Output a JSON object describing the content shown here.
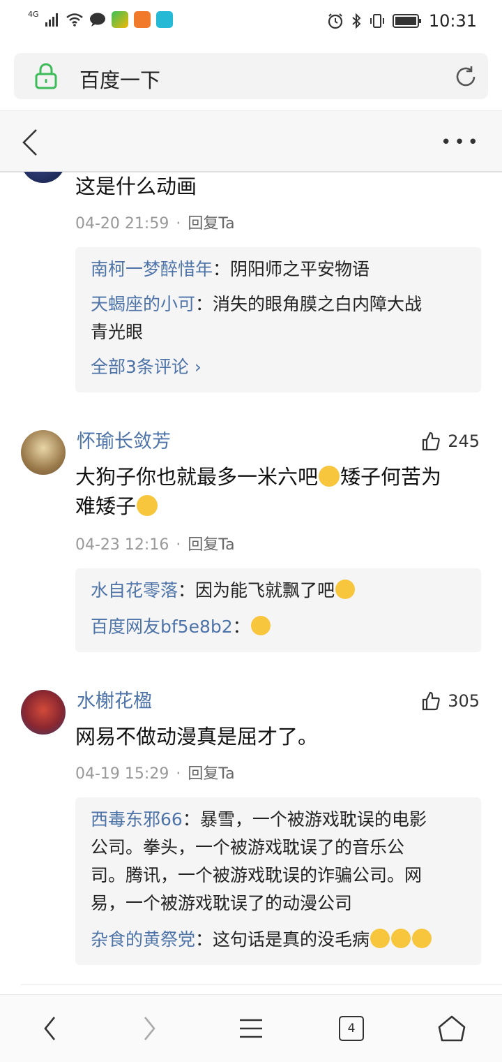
{
  "status_bar": {
    "network": "4G",
    "time": "10:31"
  },
  "url_bar": {
    "title": "百度一下"
  },
  "comments_top_fragment": {
    "text": "这是什么动画",
    "time": "04-20 21:59",
    "sep": "·",
    "reply_label": "回复Ta",
    "replies": [
      {
        "name": "南柯一梦醉惜年",
        "colon": "：",
        "text": "阴阳师之平安物语"
      },
      {
        "name": "天蝎座的小可",
        "colon": "：",
        "text": "消失的眼角膜之白内障大战",
        "text2": "青光眼"
      }
    ],
    "all_label": "全部3条评论 ›"
  },
  "comment_2": {
    "username": "怀瑜长敛芳",
    "likes": "245",
    "text_a": "大狗子你也就最多一米六吧",
    "text_b": "矮子何苦为",
    "text_c": "难矮子",
    "time": "04-23 12:16",
    "sep": "·",
    "reply_label": "回复Ta",
    "replies": [
      {
        "name": "水自花零落",
        "colon": "：",
        "text": "因为能飞就飘了吧"
      },
      {
        "name": "百度网友bf5e8b2",
        "colon": "：",
        "text": ""
      }
    ]
  },
  "comment_3": {
    "username": "水榭花楹",
    "likes": "305",
    "text": "网易不做动漫真是屈才了。",
    "time": "04-19 15:29",
    "sep": "·",
    "reply_label": "回复Ta",
    "replies": [
      {
        "name": "西毒东邪66",
        "colon": "：",
        "line1": "暴雪，一个被游戏耽误的电影",
        "line2": "公司。拳头，一个被游戏耽误了的音乐公",
        "line3": "司。腾讯，一个被游戏耽误的诈骗公司。网",
        "line4": "易，一个被游戏耽误了的动漫公司"
      },
      {
        "name": "杂食的黄祭党",
        "colon": "：",
        "text": "这句话是真的没毛病"
      }
    ]
  },
  "bottom_bar": {
    "tab_count": "4"
  },
  "colors": {
    "link_blue": "#4d73a8",
    "lock_green": "#3dbb5a",
    "reply_bg": "#f5f5f5"
  }
}
